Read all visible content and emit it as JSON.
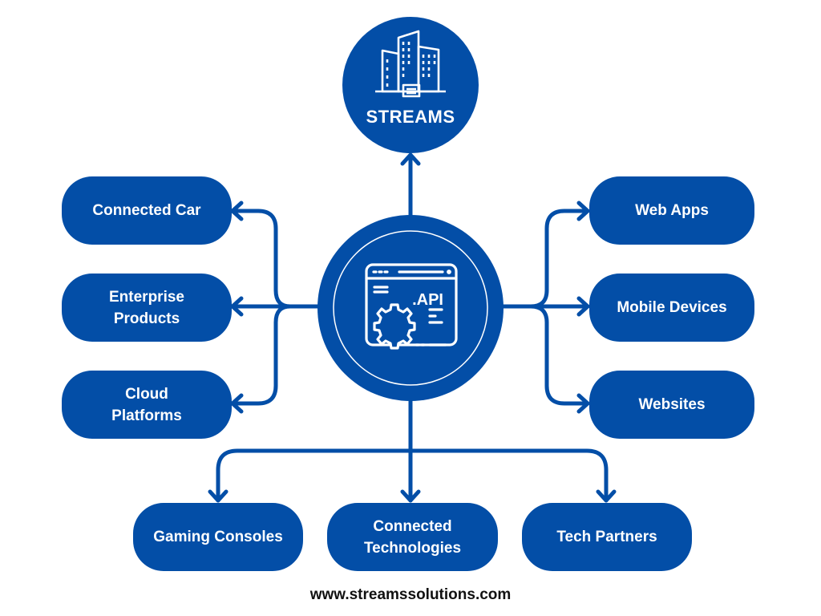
{
  "colors": {
    "primary": "#034ea7",
    "text_on_primary": "#ffffff",
    "footer_text": "#111111",
    "background": "#ffffff"
  },
  "top_node": {
    "label": "STREAMS",
    "icon": "office-buildings-icon"
  },
  "center_node": {
    "icon": "api-window-gear-icon",
    "icon_text": ".API"
  },
  "left_nodes": [
    {
      "lines": [
        "Connected Car"
      ]
    },
    {
      "lines": [
        "Enterprise",
        "Products"
      ]
    },
    {
      "lines": [
        "Cloud",
        "Platforms"
      ]
    }
  ],
  "right_nodes": [
    {
      "lines": [
        "Web Apps"
      ]
    },
    {
      "lines": [
        "Mobile Devices"
      ]
    },
    {
      "lines": [
        "Websites"
      ]
    }
  ],
  "bottom_nodes": [
    {
      "lines": [
        "Gaming Consoles"
      ]
    },
    {
      "lines": [
        "Connected",
        "Technologies"
      ]
    },
    {
      "lines": [
        "Tech Partners"
      ]
    }
  ],
  "footer": {
    "url_text": "www.streamssolutions.com"
  }
}
